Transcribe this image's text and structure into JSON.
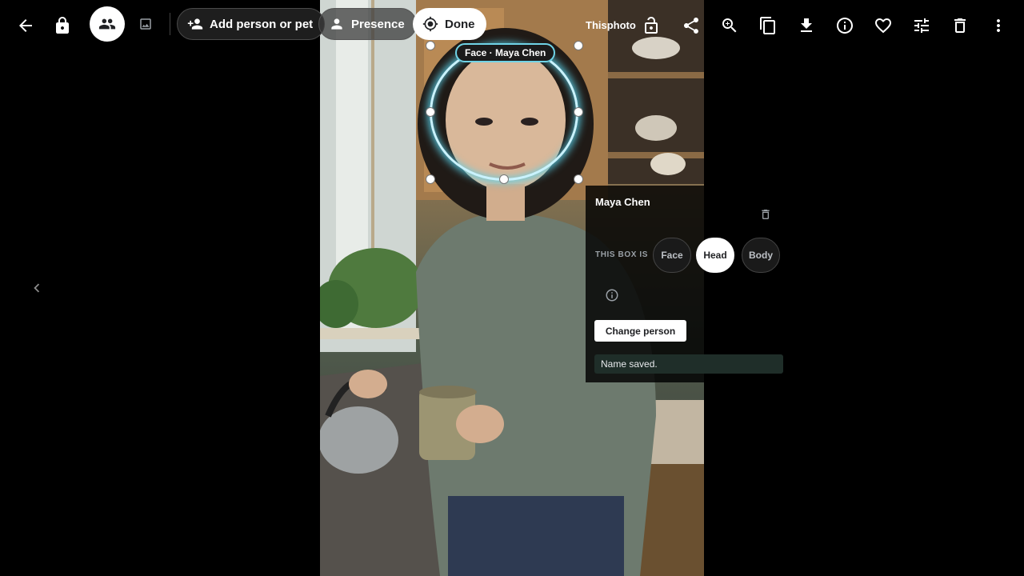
{
  "toolbar": {
    "add_person_label": "Add person or pet",
    "presence_label": "Presence",
    "done_label": "Done",
    "scope_label": "Thisphoto"
  },
  "face_box": {
    "label": "Face · Maya Chen",
    "ring_color": "#6fd3e6"
  },
  "panel": {
    "person_name": "Maya Chen",
    "box_type_label": "THIS BOX IS",
    "box_type_options": [
      "Face",
      "Head",
      "Body"
    ],
    "selected_box_type": "Head",
    "change_person_label": "Change person",
    "status_message": "Name saved."
  },
  "icons": {
    "left": [
      "back-arrow-icon",
      "lock-icon",
      "people-icon",
      "image-icon"
    ],
    "right": [
      "unlock-icon",
      "share-icon",
      "zoom-in-icon",
      "copy-icon",
      "download-icon",
      "info-icon",
      "heart-icon",
      "tune-icon",
      "trash-icon",
      "more-vert-icon"
    ]
  },
  "colors": {
    "background": "#000000",
    "accent_ring": "#6fd3e6",
    "toast_bg": "#1f2e29"
  }
}
